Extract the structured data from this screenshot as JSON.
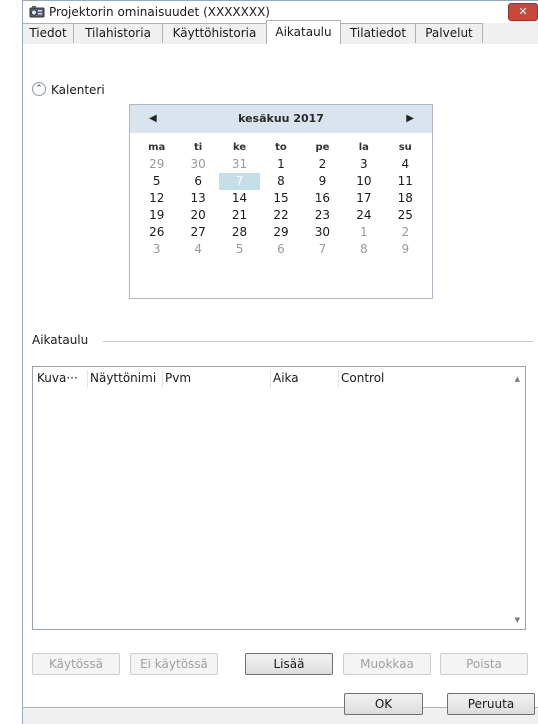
{
  "window": {
    "title": "Projektorin ominaisuudet (XXXXXXX)",
    "close_symbol": "✕"
  },
  "tabs": [
    {
      "label": "Tiedot",
      "active": false
    },
    {
      "label": "Tilahistoria",
      "active": false
    },
    {
      "label": "Käyttöhistoria",
      "active": false
    },
    {
      "label": "Aikataulu",
      "active": true
    },
    {
      "label": "Tilatiedot",
      "active": false
    },
    {
      "label": "Palvelut",
      "active": false
    }
  ],
  "calendar_section": {
    "label": "Kalenteri",
    "toggle_symbol": "⌃"
  },
  "calendar": {
    "month_label": "kesäkuu 2017",
    "prev_symbol": "◀",
    "next_symbol": "▶",
    "weekdays": [
      "ma",
      "ti",
      "ke",
      "to",
      "pe",
      "la",
      "su"
    ],
    "weeks": [
      [
        "29",
        "30",
        "31",
        "1",
        "2",
        "3",
        "4"
      ],
      [
        "5",
        "6",
        "7",
        "8",
        "9",
        "10",
        "11"
      ],
      [
        "12",
        "13",
        "14",
        "15",
        "16",
        "17",
        "18"
      ],
      [
        "19",
        "20",
        "21",
        "22",
        "23",
        "24",
        "25"
      ],
      [
        "26",
        "27",
        "28",
        "29",
        "30",
        "1",
        "2"
      ],
      [
        "3",
        "4",
        "5",
        "6",
        "7",
        "8",
        "9"
      ]
    ],
    "selected": "7"
  },
  "schedule_section": {
    "label": "Aikataulu"
  },
  "table": {
    "columns": [
      "Kuva···",
      "Näyttönimi",
      "Pvm",
      "Aika",
      "Control"
    ],
    "rows": [],
    "scroll_up_symbol": "▲",
    "scroll_down_symbol": "▼"
  },
  "actions": {
    "enable_label": "Käytössä",
    "disable_label": "Ei käytössä",
    "add_label": "Lisää",
    "edit_label": "Muokkaa",
    "delete_label": "Poista"
  },
  "footer": {
    "ok_label": "OK",
    "cancel_label": "Peruuta"
  },
  "colors": {
    "calendar_header": "#d9e4ee",
    "selected_day": "#c5dfe9",
    "close_button": "#c9483c"
  }
}
